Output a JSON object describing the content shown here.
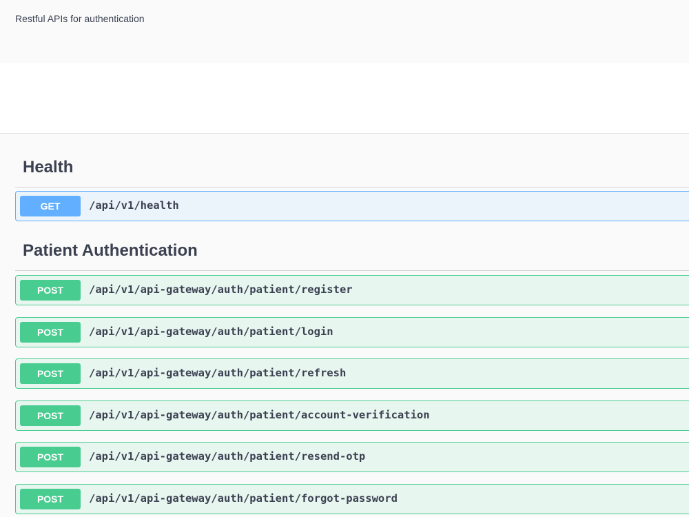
{
  "info": {
    "description": "Restful APIs for authentication"
  },
  "health": {
    "title": "Health",
    "operations": [
      {
        "method": "GET",
        "path": "/api/v1/health"
      }
    ]
  },
  "patient_auth": {
    "title": "Patient Authentication",
    "operations": [
      {
        "method": "POST",
        "path": "/api/v1/api-gateway/auth/patient/register"
      },
      {
        "method": "POST",
        "path": "/api/v1/api-gateway/auth/patient/login"
      },
      {
        "method": "POST",
        "path": "/api/v1/api-gateway/auth/patient/refresh"
      },
      {
        "method": "POST",
        "path": "/api/v1/api-gateway/auth/patient/account-verification"
      },
      {
        "method": "POST",
        "path": "/api/v1/api-gateway/auth/patient/resend-otp"
      },
      {
        "method": "POST",
        "path": "/api/v1/api-gateway/auth/patient/forgot-password"
      }
    ]
  },
  "colors": {
    "get": "#61affe",
    "post": "#49cc90",
    "text": "#3b4151"
  }
}
